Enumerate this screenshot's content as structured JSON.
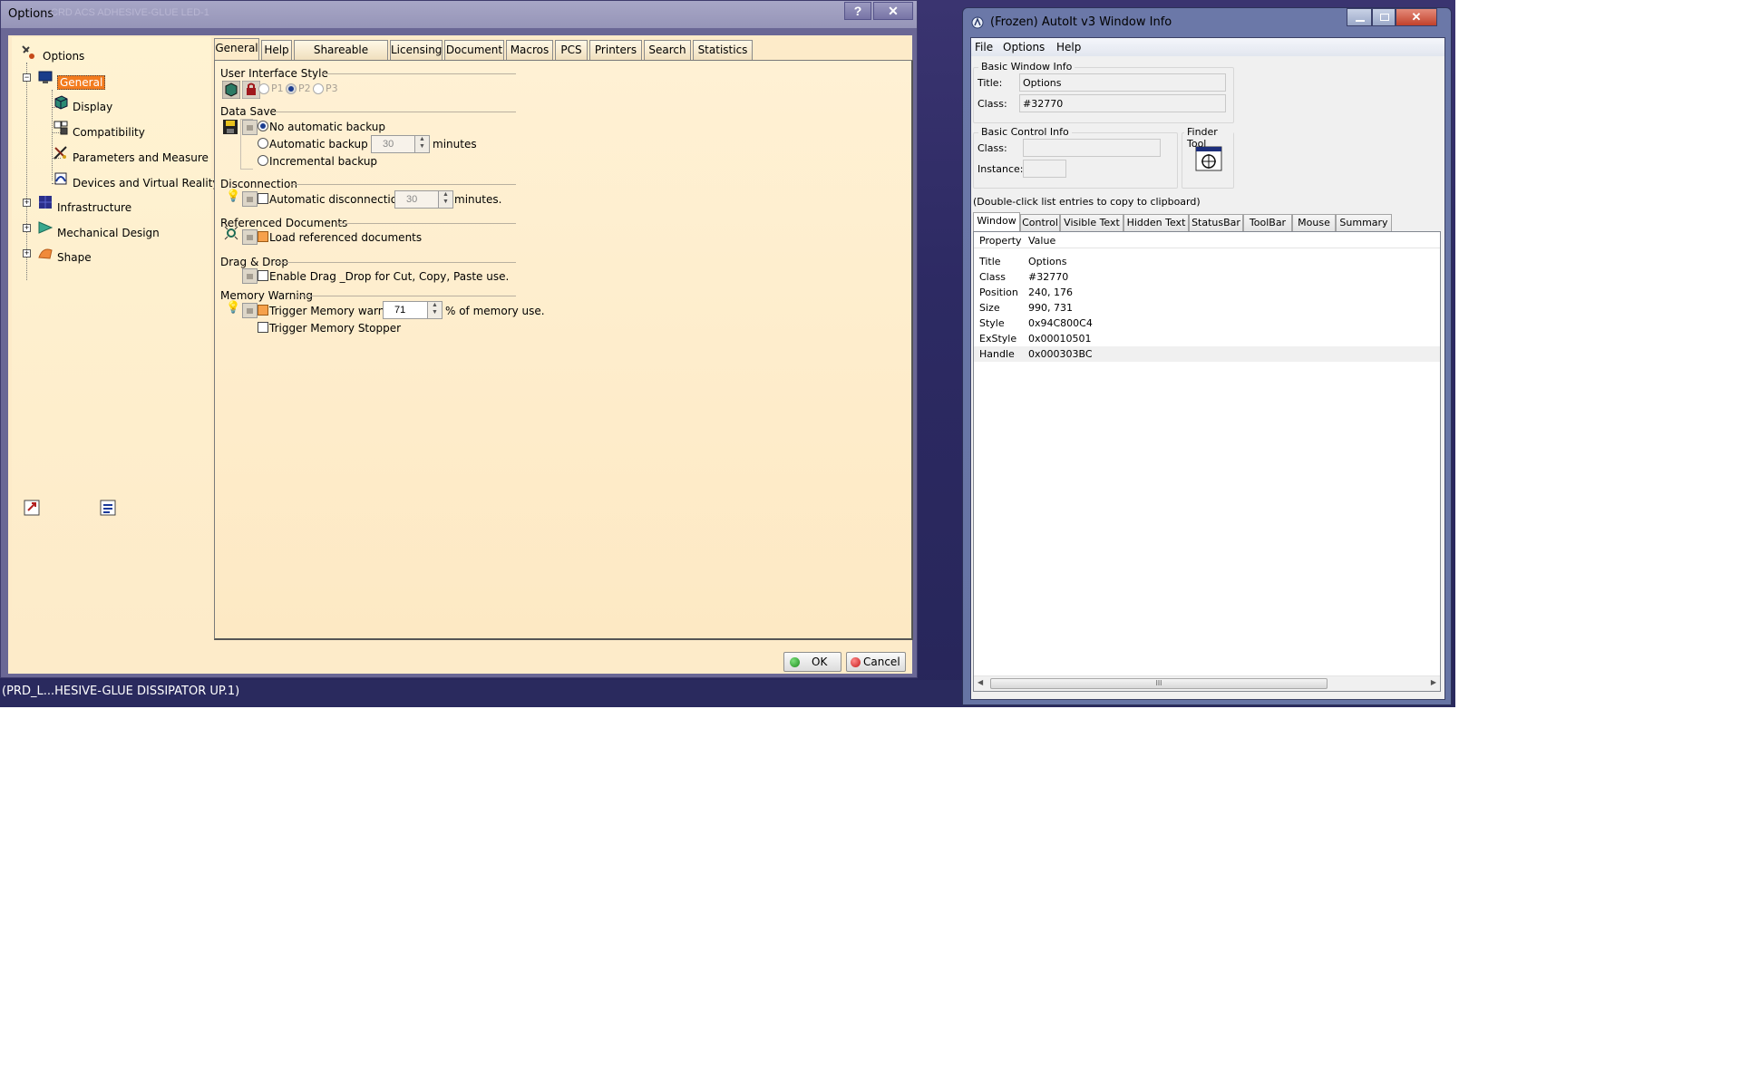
{
  "options_window": {
    "title": "Options",
    "title_ghost": "CRD ACS ADHESIVE-GLUE LED-1",
    "help_btn": "?",
    "close_btn": "✕",
    "tree": {
      "root": "Options",
      "items": [
        {
          "label": "General",
          "selected": true
        },
        {
          "label": "Display"
        },
        {
          "label": "Compatibility"
        },
        {
          "label": "Parameters and Measure"
        },
        {
          "label": "Devices and Virtual Reality"
        },
        {
          "label": "Infrastructure"
        },
        {
          "label": "Mechanical Design"
        },
        {
          "label": "Shape"
        }
      ]
    },
    "tabs": [
      "General",
      "Help",
      "Shareable Products",
      "Licensing",
      "Document",
      "Macros",
      "PCS",
      "Printers",
      "Search",
      "Statistics"
    ],
    "active_tab": "General",
    "sections": {
      "ui_style": {
        "title": "User Interface Style",
        "options": [
          "P1",
          "P2",
          "P3"
        ],
        "selected": "P2"
      },
      "data_save": {
        "title": "Data Save",
        "no_backup": "No automatic backup",
        "auto_backup": "Automatic backup every",
        "auto_backup_value": "30",
        "auto_backup_unit": "minutes",
        "incremental": "Incremental backup",
        "selected": "No automatic backup"
      },
      "disconnection": {
        "title": "Disconnection",
        "label": "Automatic disconnection after",
        "value": "30",
        "unit": "minutes.",
        "checked": false
      },
      "referenced_documents": {
        "title": "Referenced Documents",
        "label": "Load referenced documents",
        "checked": true
      },
      "drag_drop": {
        "title": "Drag & Drop",
        "label": "Enable Drag _Drop for Cut, Copy, Paste use.",
        "checked": false
      },
      "memory_warning": {
        "title": "Memory Warning",
        "trigger_label": "Trigger Memory warning at",
        "trigger_value": "71",
        "trigger_unit": "% of memory use.",
        "trigger_checked": true,
        "stopper_label": "Trigger Memory Stopper",
        "stopper_checked": false
      }
    },
    "ok_label": "OK",
    "cancel_label": "Cancel"
  },
  "status_strip": "(PRD_L...HESIVE-GLUE DISSIPATOR UP.1)",
  "autoit_window": {
    "title": "(Frozen) AutoIt v3 Window Info",
    "menu": [
      "File",
      "Options",
      "Help"
    ],
    "basic_window_info": {
      "title": "Basic Window Info",
      "title_label": "Title:",
      "title_value": "Options",
      "class_label": "Class:",
      "class_value": "#32770"
    },
    "basic_control_info": {
      "title": "Basic Control Info",
      "class_label": "Class:",
      "class_value": "",
      "instance_label": "Instance:",
      "instance_value": ""
    },
    "finder_tool": "Finder Tool",
    "hint": "(Double-click list entries to copy to clipboard)",
    "tabs": [
      "Window",
      "Control",
      "Visible Text",
      "Hidden Text",
      "StatusBar",
      "ToolBar",
      "Mouse",
      "Summary"
    ],
    "active_tab": "Window",
    "list_headers": [
      "Property",
      "Value"
    ],
    "rows": [
      {
        "property": "Title",
        "value": "Options"
      },
      {
        "property": "Class",
        "value": "#32770"
      },
      {
        "property": "Position",
        "value": "240, 176"
      },
      {
        "property": "Size",
        "value": "990, 731"
      },
      {
        "property": "Style",
        "value": "0x94C800C4"
      },
      {
        "property": "ExStyle",
        "value": "0x00010501"
      },
      {
        "property": "Handle",
        "value": "0x000303BC"
      }
    ],
    "scroll_grip": "III"
  },
  "colors": {
    "options_bg": "#fdebc9",
    "selected_tree": "#f37b1e",
    "desktop": "#2d2a63"
  }
}
